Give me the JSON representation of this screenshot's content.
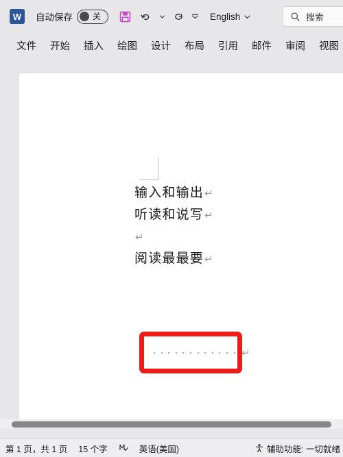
{
  "titlebar": {
    "app_logo_letter": "W",
    "app_logo_name": "word-logo",
    "autosave_label": "自动保存",
    "autosave_state": "关",
    "save_icon": "save-icon",
    "save_icon_color": "#c34bc6",
    "undo_icon": "undo-icon",
    "undo_dropdown_icon": "chevron-down-icon",
    "redo_icon": "redo-icon",
    "customize_qat_icon": "chevron-down-icon",
    "language": "English",
    "language_dropdown_icon": "chevron-down-icon",
    "search_icon": "search-icon",
    "search_placeholder": "搜索"
  },
  "ribbon": {
    "tabs": [
      {
        "label": "文件"
      },
      {
        "label": "开始"
      },
      {
        "label": "插入"
      },
      {
        "label": "绘图"
      },
      {
        "label": "设计"
      },
      {
        "label": "布局"
      },
      {
        "label": "引用"
      },
      {
        "label": "邮件"
      },
      {
        "label": "审阅"
      },
      {
        "label": "视图"
      }
    ]
  },
  "document": {
    "lines": [
      {
        "text": "输入和输出",
        "mark": "↵"
      },
      {
        "text": "听读和说写",
        "mark": "↵"
      },
      {
        "text": "",
        "mark": "↵"
      },
      {
        "text": "阅读最最要",
        "mark": "↵"
      }
    ],
    "dot_leader_line": {
      "dot_count": 12,
      "dot_icon": "space-mark-dot",
      "caret": "text-cursor",
      "mark": "↵"
    }
  },
  "annotation": {
    "red_box_color": "#ee1b17",
    "red_box_label": "highlight-rectangle"
  },
  "statusbar": {
    "page_info": "第 1 页，共 1 页",
    "word_count": "15 个字",
    "proofing_icon": "proofing-errors-icon",
    "language": "英语(美国)",
    "accessibility_icon": "accessibility-icon",
    "accessibility_text": "辅助功能: 一切就绪"
  },
  "scrollbar": {
    "horizontal_name": "horizontal-scrollbar"
  }
}
